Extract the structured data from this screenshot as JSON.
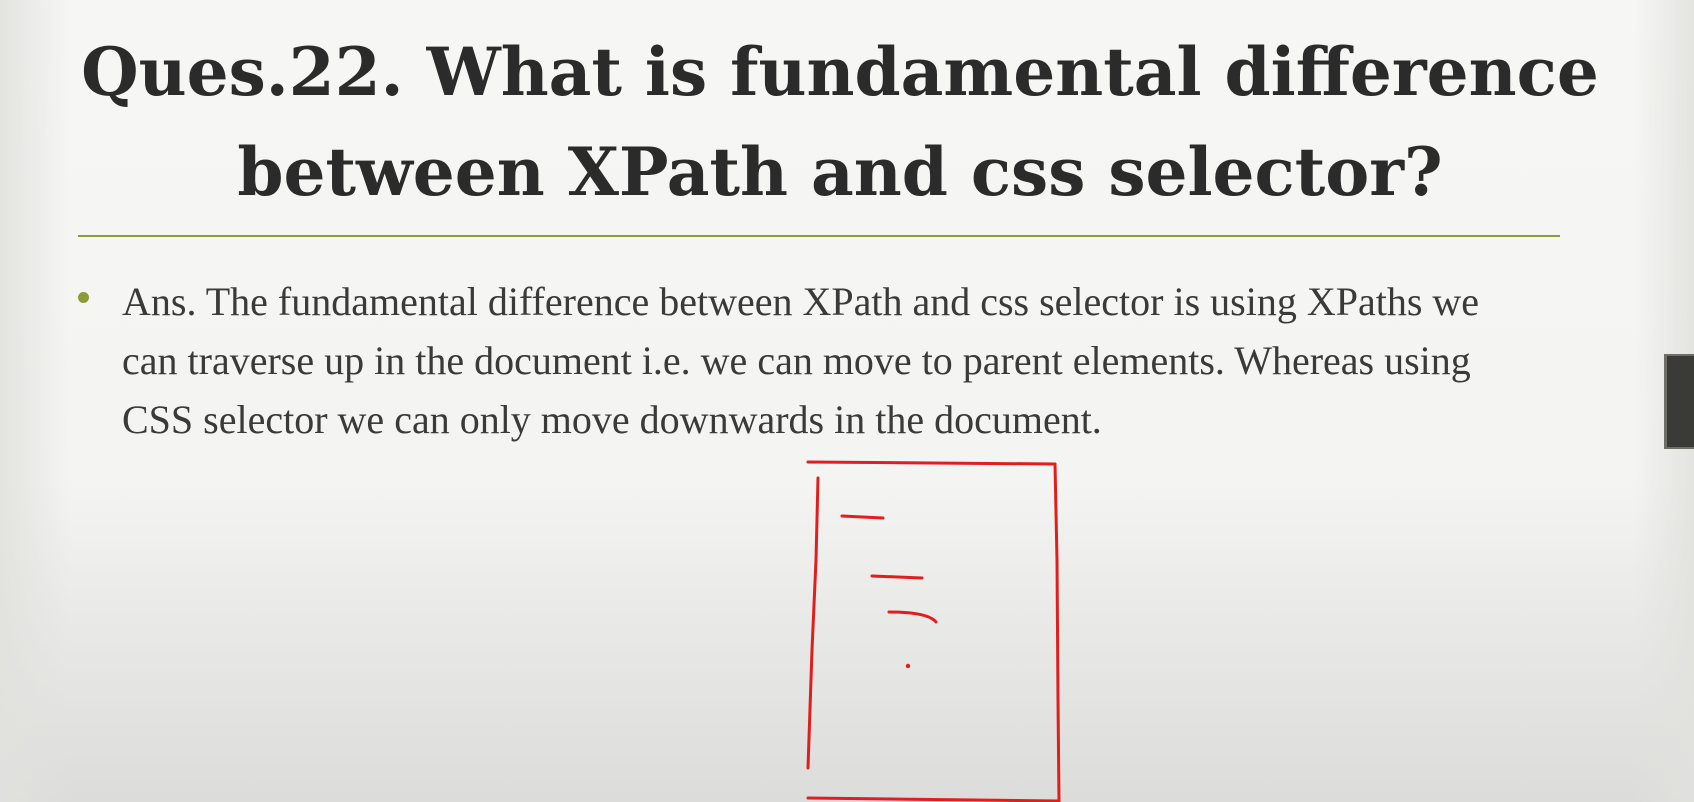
{
  "slide": {
    "title": "Ques.22. What is fundamental difference between XPath and css selector?",
    "bullets": [
      {
        "text": "Ans. The fundamental difference between XPath and css selector is using XPaths we can traverse up in the document i.e. we can move to parent elements. Whereas using CSS selector we can only move downwards in the document."
      }
    ]
  },
  "colors": {
    "accent": "#8d9a3a",
    "title_text": "#2b2b2b",
    "body_text": "#3a3a3a",
    "annotation": "#e01e1e"
  },
  "icons": {
    "bullet": "bullet-dot-icon",
    "annotation": "hand-drawn-document-sketch"
  }
}
